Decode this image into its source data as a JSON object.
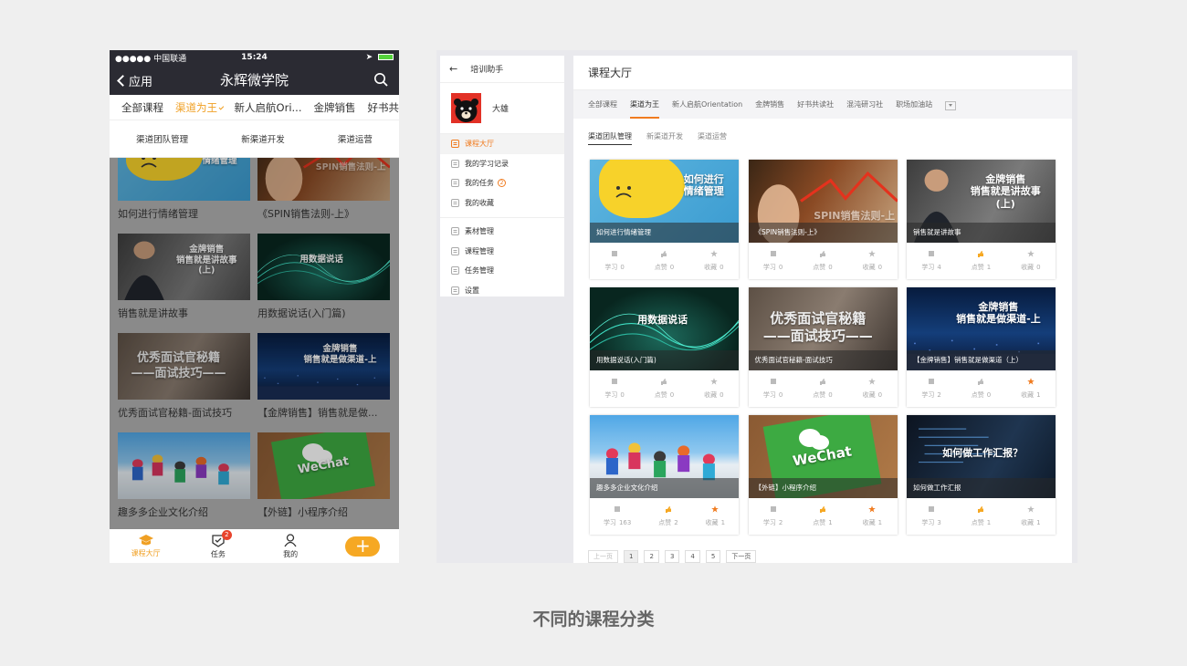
{
  "phone": {
    "status": {
      "carrier": "●●●●● 中国联通",
      "time": "15:24"
    },
    "nav": {
      "back_label": "应用",
      "title": "永辉微学院"
    },
    "tabs": [
      "全部课程",
      "渠道为王",
      "新人启航Ori...",
      "金牌销售",
      "好书共"
    ],
    "active_tab": 1,
    "subtabs": [
      "渠道团队管理",
      "新渠道开发",
      "渠道运营"
    ],
    "courses": [
      {
        "title": "如何进行情绪管理",
        "art": "sad",
        "overlay": "如何进行\n情绪管理"
      },
      {
        "title": "《SPIN销售法则-上》",
        "art": "red",
        "overlay": "SPIN销售法则-上"
      },
      {
        "title": "销售就是讲故事",
        "art": "gray",
        "overlay": "金牌销售\n销售就是讲故事\n(上)"
      },
      {
        "title": "用数据说话(入门篇)",
        "art": "wave",
        "overlay": "用数据说话"
      },
      {
        "title": "优秀面试官秘籍-面试技巧",
        "art": "office",
        "overlay": "优秀面试官秘籍\n——面试技巧——"
      },
      {
        "title": "【金牌销售】销售就是做...",
        "art": "city",
        "overlay": "金牌销售\n销售就是做渠道-上"
      },
      {
        "title": "趣多多企业文化介绍",
        "art": "snow",
        "overlay": ""
      },
      {
        "title": "【外链】小程序介绍",
        "art": "wechat",
        "overlay": "WeChat"
      }
    ],
    "bottom_nav": [
      {
        "label": "课程大厅",
        "icon": "graduation-cap-icon"
      },
      {
        "label": "任务",
        "icon": "task-check-icon",
        "badge": "2"
      },
      {
        "label": "我的",
        "icon": "person-icon"
      }
    ],
    "plus_label": "+"
  },
  "desktop": {
    "sidebar": {
      "header": "培训助手",
      "user_name": "大雄",
      "menu1": [
        {
          "label": "课程大厅",
          "icon": "list-icon"
        },
        {
          "label": "我的学习记录",
          "icon": "clock-icon"
        },
        {
          "label": "我的任务",
          "icon": "shield-icon",
          "badge": "2"
        },
        {
          "label": "我的收藏",
          "icon": "folder-icon"
        }
      ],
      "menu2": [
        {
          "label": "素材管理",
          "icon": "copy-icon"
        },
        {
          "label": "课程管理",
          "icon": "document-icon"
        },
        {
          "label": "任务管理",
          "icon": "clipboard-icon"
        },
        {
          "label": "设置",
          "icon": "gear-icon"
        }
      ]
    },
    "title": "课程大厅",
    "tabs": [
      "全部课程",
      "渠道为王",
      "新人启航Orientation",
      "金牌销售",
      "好书共读社",
      "混沌研习社",
      "职场加油站"
    ],
    "active_tab": 1,
    "subtabs": [
      "渠道团队管理",
      "新渠道开发",
      "渠道运营"
    ],
    "stat_labels": [
      "学习",
      "点赞",
      "收藏"
    ],
    "courses": [
      {
        "title": "如何进行情绪管理",
        "art": "sad",
        "overlay": "如何进行\n情绪管理",
        "study": 0,
        "like": 0,
        "fav": 0,
        "liked": false,
        "faved": false
      },
      {
        "title": "《SPIN销售法则-上》",
        "art": "red",
        "overlay": "SPIN销售法则-上",
        "study": 0,
        "like": 0,
        "fav": 0,
        "liked": false,
        "faved": false
      },
      {
        "title": "销售就是讲故事",
        "art": "gray",
        "overlay": "金牌销售\n销售就是讲故事\n(上)",
        "study": 4,
        "like": 1,
        "fav": 0,
        "liked": true,
        "faved": false
      },
      {
        "title": "用数据说话(入门篇)",
        "art": "wave",
        "overlay": "用数据说话",
        "study": 0,
        "like": 0,
        "fav": 0,
        "liked": false,
        "faved": false
      },
      {
        "title": "优秀面试官秘籍-面试技巧",
        "art": "office",
        "overlay": "优秀面试官秘籍\n——面试技巧——",
        "study": 0,
        "like": 0,
        "fav": 0,
        "liked": false,
        "faved": false
      },
      {
        "title": "【金牌销售】销售就是做渠道（上）",
        "art": "city",
        "overlay": "金牌销售\n销售就是做渠道-上",
        "study": 2,
        "like": 0,
        "fav": 1,
        "liked": false,
        "faved": true
      },
      {
        "title": "趣多多企业文化介绍",
        "art": "snow",
        "overlay": "",
        "study": 163,
        "like": 2,
        "fav": 1,
        "liked": true,
        "faved": true
      },
      {
        "title": "【外链】小程序介绍",
        "art": "wechat",
        "overlay": "WeChat",
        "study": 2,
        "like": 1,
        "fav": 1,
        "liked": true,
        "faved": true
      },
      {
        "title": "如何做工作汇报",
        "art": "code",
        "overlay": "如何做工作汇报？",
        "study": 3,
        "like": 1,
        "fav": 1,
        "liked": true,
        "faved": false
      }
    ],
    "pager": {
      "prev": "上一页",
      "pages": [
        "1",
        "2",
        "3",
        "4",
        "5"
      ],
      "current": "1",
      "next": "下一页"
    }
  },
  "caption": "不同的课程分类",
  "colors": {
    "accent": "#f07b1f",
    "phone_accent": "#f0a024",
    "nav_dark": "#2b2b33"
  }
}
